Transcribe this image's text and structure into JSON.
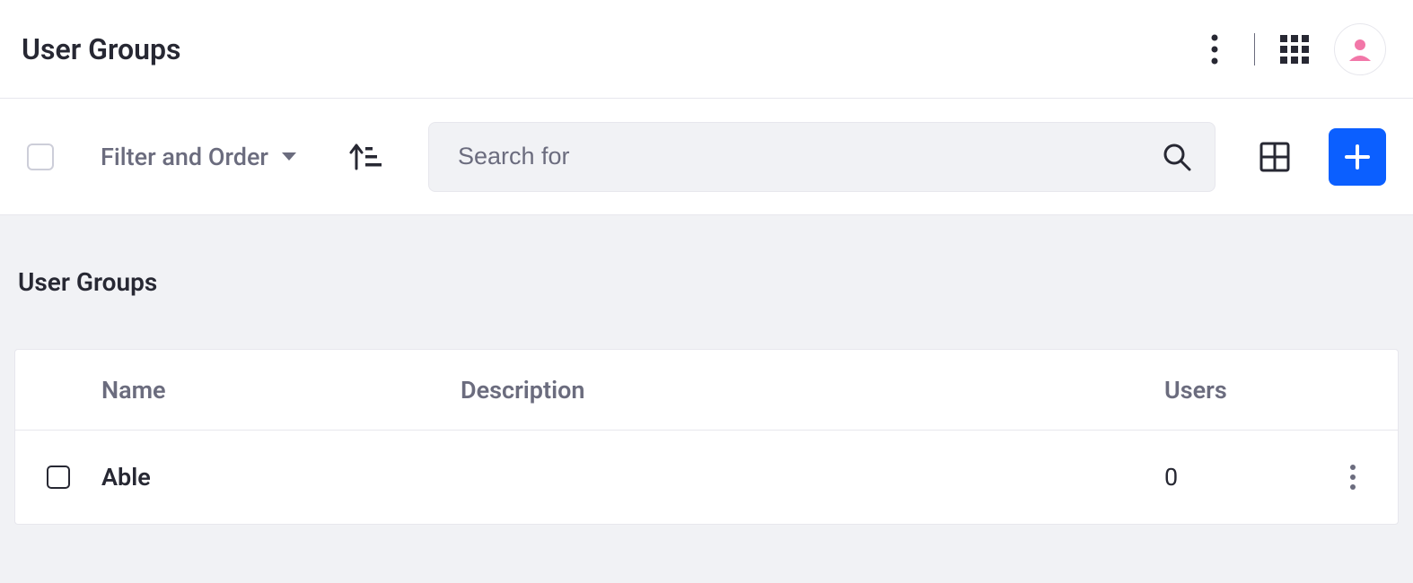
{
  "header": {
    "title": "User Groups"
  },
  "toolbar": {
    "filter_label": "Filter and Order",
    "search_placeholder": "Search for"
  },
  "section": {
    "title": "User Groups"
  },
  "table": {
    "headers": {
      "name": "Name",
      "description": "Description",
      "users": "Users"
    },
    "rows": [
      {
        "name": "Able",
        "description": "",
        "users": "0"
      }
    ]
  }
}
